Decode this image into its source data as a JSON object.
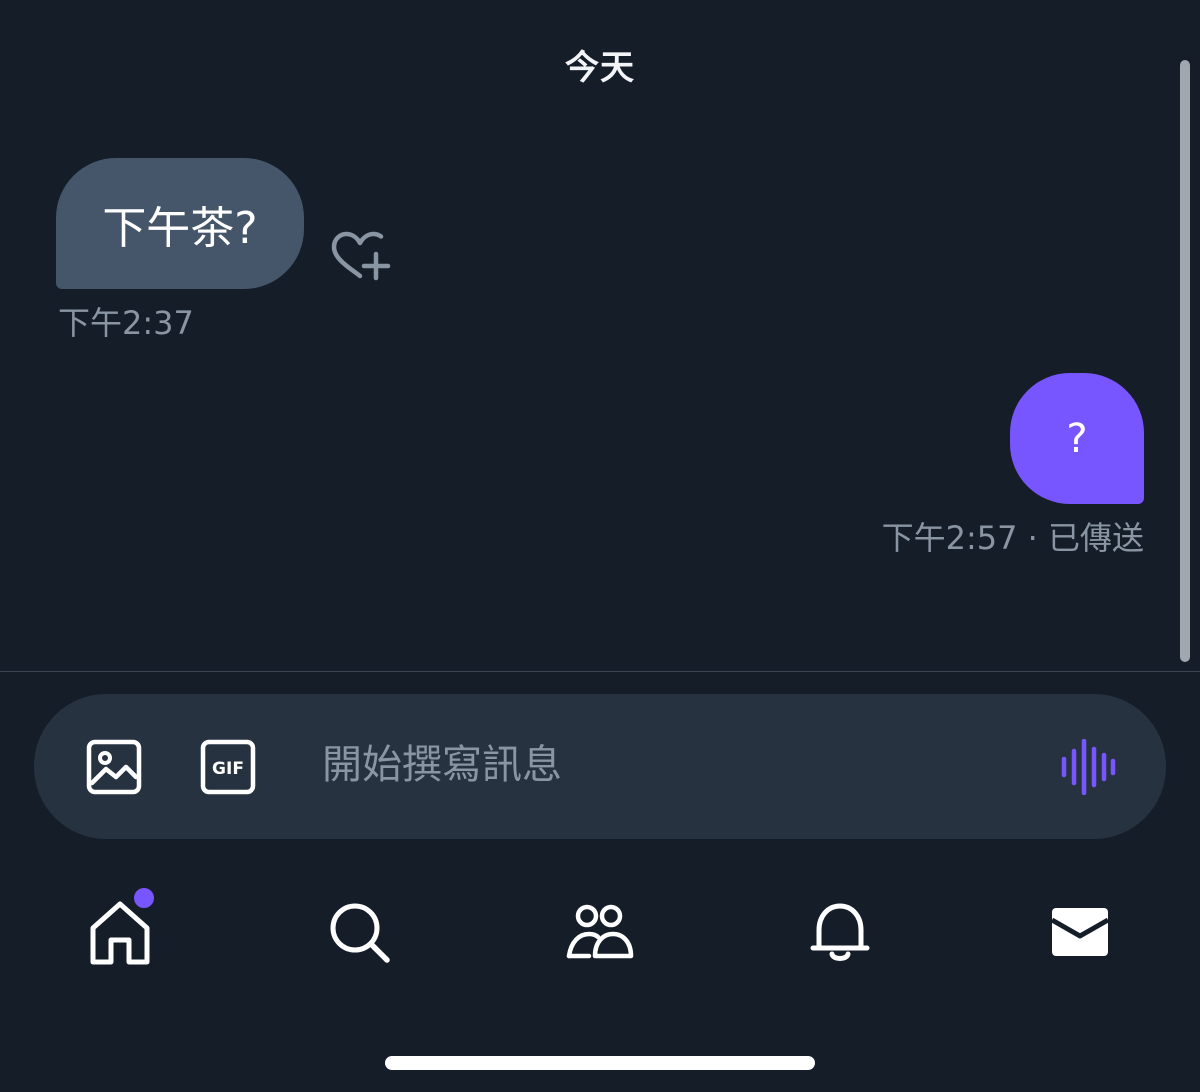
{
  "header": {
    "date_label": "今天"
  },
  "messages": [
    {
      "direction": "incoming",
      "text": "下午茶?",
      "time": "下午2:37"
    },
    {
      "direction": "outgoing",
      "text": "?",
      "status": "下午2:57 · 已傳送"
    }
  ],
  "composer": {
    "placeholder": "開始撰寫訊息",
    "image_icon": "image-icon",
    "gif_icon": "gif-icon",
    "voice_icon": "voice-waveform-icon"
  },
  "gif_label": "GIF",
  "nav": {
    "items": [
      {
        "icon": "home-icon",
        "has_badge": true
      },
      {
        "icon": "search-icon"
      },
      {
        "icon": "communities-icon"
      },
      {
        "icon": "notifications-bell-icon"
      },
      {
        "icon": "messages-envelope-icon",
        "active": true
      }
    ]
  },
  "colors": {
    "background": "#151d29",
    "incoming_bubble": "#46566a",
    "outgoing_bubble": "#7856ff",
    "composer": "#273241",
    "muted_text": "#8a95a3",
    "accent": "#7856ff"
  }
}
